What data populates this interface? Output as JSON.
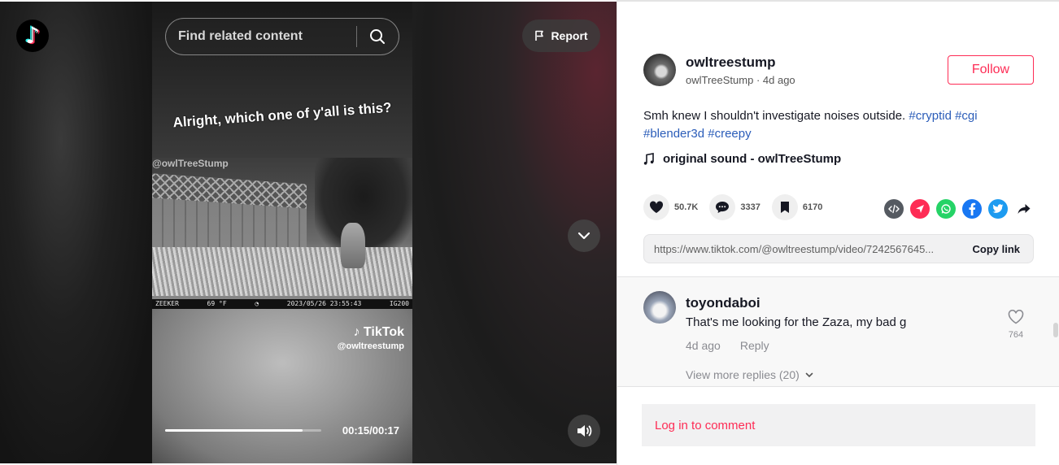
{
  "search": {
    "placeholder": "Find related content"
  },
  "report": {
    "label": "Report"
  },
  "video": {
    "caption": "Alright, which one of y'all is this?",
    "camera_watermark": "@owlTreeStump",
    "stamp": [
      "ZEEKER",
      "69 °F",
      "◔",
      "2023/05/26  23:55:43",
      "IG200"
    ],
    "brand": "TikTok",
    "handle": "@owltreestump",
    "time": "00:15/00:17",
    "progress_fraction": 0.88
  },
  "author": {
    "username": "owltreestump",
    "nickname": "owlTreeStump",
    "posted": "4d ago",
    "follow_label": "Follow"
  },
  "description": {
    "text": "Smh knew I shouldn't investigate noises outside. ",
    "tags": [
      "#cryptid",
      "#cgi",
      "#blender3d",
      "#creepy"
    ]
  },
  "music": {
    "label": "original sound - owlTreeStump"
  },
  "stats": {
    "likes": "50.7K",
    "comments": "3337",
    "saves": "6170"
  },
  "share_icons": [
    {
      "name": "embed",
      "color": "#555a61"
    },
    {
      "name": "send-to-friends",
      "color": "#fe2c55"
    },
    {
      "name": "whatsapp",
      "color": "#25d366"
    },
    {
      "name": "facebook",
      "color": "#1877f2"
    },
    {
      "name": "twitter",
      "color": "#1d9bf0"
    },
    {
      "name": "share-more",
      "color": "#161823"
    }
  ],
  "link": {
    "url": "https://www.tiktok.com/@owltreestump/video/7242567645...",
    "copy_label": "Copy link"
  },
  "comment": {
    "user": "toyondaboi",
    "text": "That's me looking for the Zaza, my bad g",
    "time": "4d ago",
    "reply_label": "Reply",
    "likes": "764",
    "more_replies": "View more replies (20)"
  },
  "login": {
    "label": "Log in to comment"
  }
}
